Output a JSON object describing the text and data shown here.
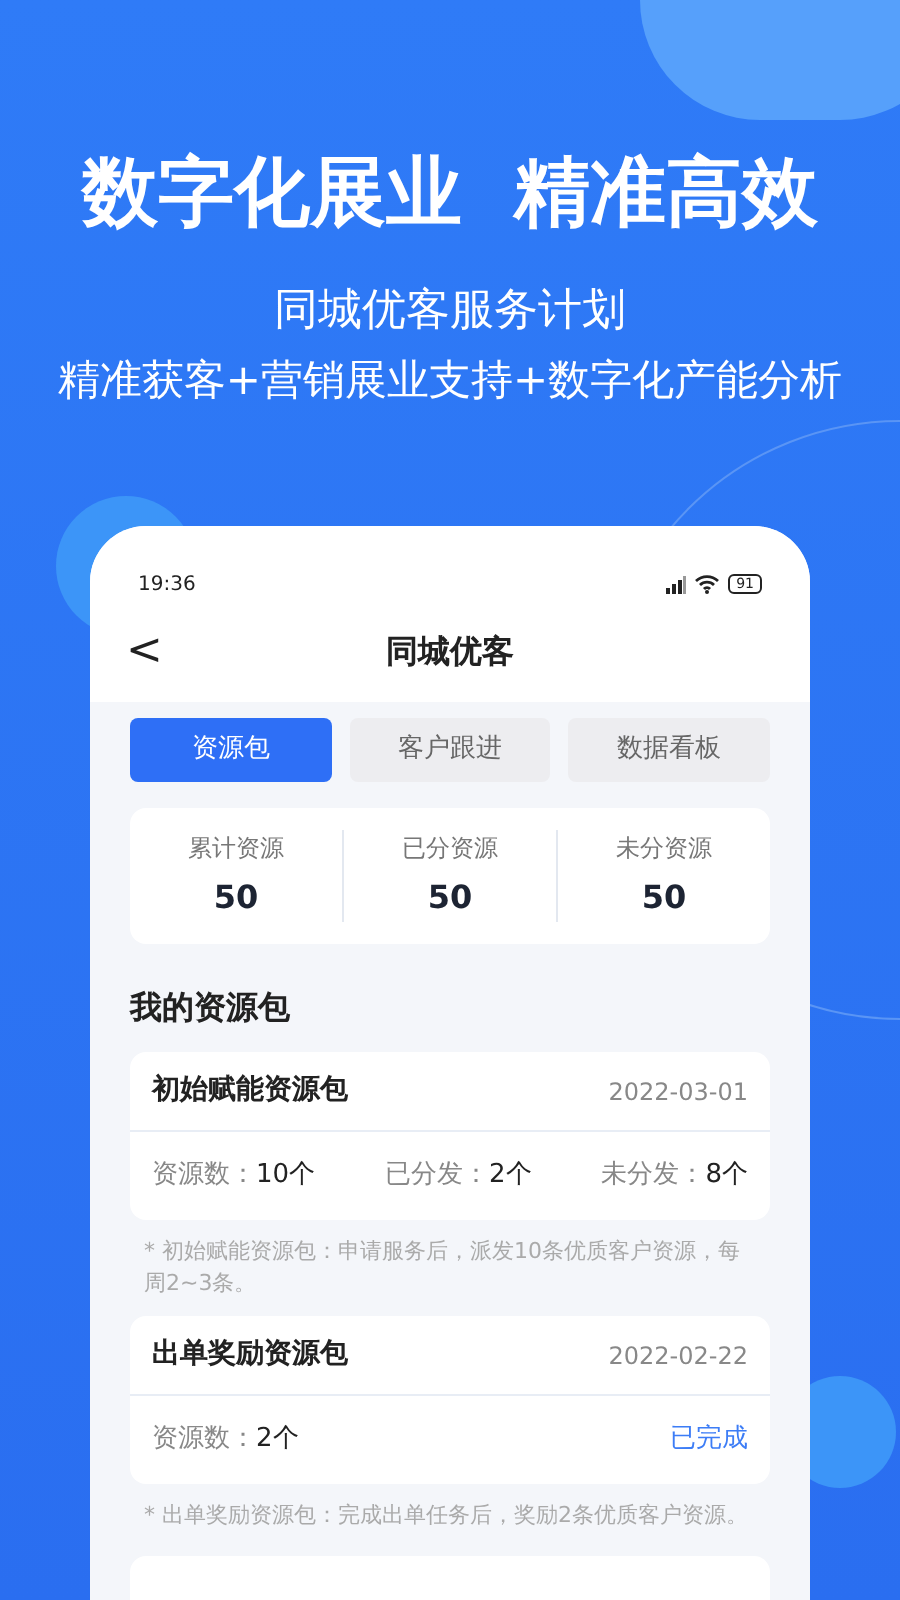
{
  "headline": "数字化展业  精准高效",
  "subtitle": "同城优客服务计划",
  "tagline": "精准获客+营销展业支持+数字化产能分析",
  "phone": {
    "status_bar": {
      "time": "19:36",
      "battery": "91"
    },
    "nav": {
      "back": "<",
      "title": "同城优客"
    },
    "tabs": [
      {
        "label": "资源包",
        "selected": true
      },
      {
        "label": "客户跟进",
        "selected": false
      },
      {
        "label": "数据看板",
        "selected": false
      }
    ],
    "summary": [
      {
        "label": "累计资源",
        "value": "50"
      },
      {
        "label": "已分资源",
        "value": "50"
      },
      {
        "label": "未分资源",
        "value": "50"
      }
    ],
    "section_title": "我的资源包",
    "packages": [
      {
        "kind": "split",
        "name": "初始赋能资源包",
        "date": "2022-03-01",
        "stats": [
          {
            "label": "资源数：",
            "value": "10个"
          },
          {
            "label": "已分发：",
            "value": "2个"
          },
          {
            "label": "未分发：",
            "value": "8个"
          }
        ],
        "note": "* 初始赋能资源包：申请服务后，派发10条优质客户资源，每周2~3条。"
      },
      {
        "kind": "done",
        "name": "出单奖励资源包",
        "date": "2022-02-22",
        "stats": [
          {
            "label": "资源数：",
            "value": "2个"
          }
        ],
        "status": "已完成",
        "note": "* 出单奖励资源包：完成出单任务后，奖励2条优质客户资源。"
      }
    ]
  }
}
